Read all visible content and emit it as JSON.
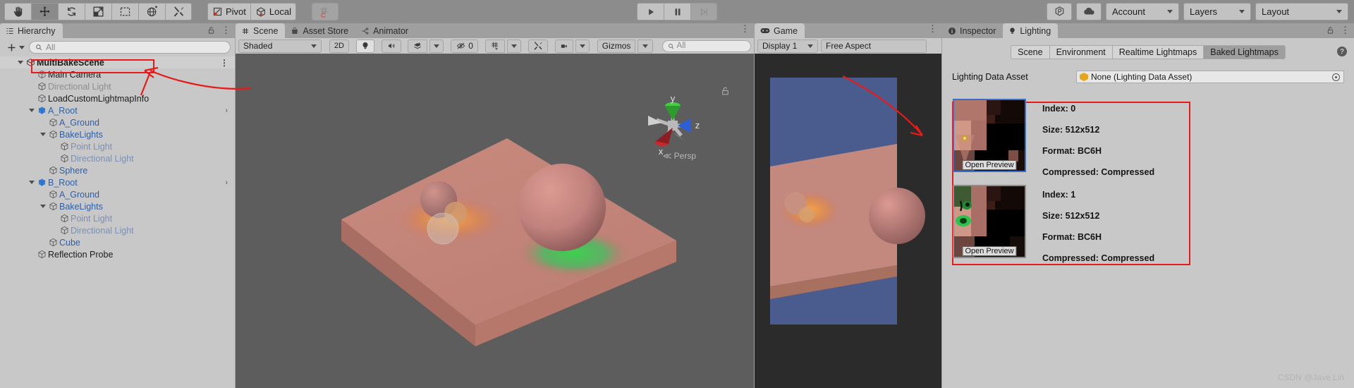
{
  "toolbar": {
    "tools": [
      {
        "name": "hand-tool",
        "icon": "hand",
        "active": false
      },
      {
        "name": "move-tool",
        "icon": "move",
        "active": true
      },
      {
        "name": "rotate-tool",
        "icon": "rotate",
        "active": false
      },
      {
        "name": "scale-tool",
        "icon": "scale",
        "active": false
      },
      {
        "name": "rect-tool",
        "icon": "rect",
        "active": false
      },
      {
        "name": "transform-tool",
        "icon": "transform",
        "active": false
      },
      {
        "name": "custom-tool",
        "icon": "wrench",
        "active": false
      }
    ],
    "pivot_label": "Pivot",
    "local_label": "Local",
    "snap_label": "",
    "play_label": "play",
    "pause_label": "pause",
    "step_label": "step",
    "collab_label": "collab",
    "cloud_label": "cloud",
    "account_label": "Account",
    "layers_label": "Layers",
    "layout_label": "Layout"
  },
  "hierarchy": {
    "tab": "Hierarchy",
    "search_placeholder": "All",
    "create_label": "+",
    "items": [
      {
        "label": "MultiBakeScene",
        "depth": 0,
        "style": "scene",
        "twisty": "open",
        "icon": "scene-icon",
        "kebab": true
      },
      {
        "label": "Main Camera",
        "depth": 1,
        "style": "normal",
        "twisty": "none",
        "icon": "gameobject-icon"
      },
      {
        "label": "Directional Light",
        "depth": 1,
        "style": "dimmed",
        "twisty": "none",
        "icon": "gameobject-icon"
      },
      {
        "label": "LoadCustomLightmapInfo",
        "depth": 1,
        "style": "normal",
        "twisty": "none",
        "icon": "gameobject-icon"
      },
      {
        "label": "A_Root",
        "depth": 1,
        "style": "blue",
        "twisty": "open",
        "icon": "prefab-icon",
        "chevron": true
      },
      {
        "label": "A_Ground",
        "depth": 2,
        "style": "blue",
        "twisty": "none",
        "icon": "gameobject-icon"
      },
      {
        "label": "BakeLights",
        "depth": 2,
        "style": "blue",
        "twisty": "open",
        "icon": "gameobject-icon"
      },
      {
        "label": "Point Light",
        "depth": 3,
        "style": "bluedim",
        "twisty": "none",
        "icon": "gameobject-icon"
      },
      {
        "label": "Directional Light",
        "depth": 3,
        "style": "bluedim",
        "twisty": "none",
        "icon": "gameobject-icon"
      },
      {
        "label": "Sphere",
        "depth": 2,
        "style": "blue",
        "twisty": "none",
        "icon": "gameobject-icon"
      },
      {
        "label": "B_Root",
        "depth": 1,
        "style": "blue",
        "twisty": "open",
        "icon": "prefab-icon",
        "chevron": true
      },
      {
        "label": "A_Ground",
        "depth": 2,
        "style": "blue",
        "twisty": "none",
        "icon": "gameobject-icon"
      },
      {
        "label": "BakeLights",
        "depth": 2,
        "style": "blue",
        "twisty": "open",
        "icon": "gameobject-icon"
      },
      {
        "label": "Point Light",
        "depth": 3,
        "style": "bluedim",
        "twisty": "none",
        "icon": "gameobject-icon"
      },
      {
        "label": "Directional Light",
        "depth": 3,
        "style": "bluedim",
        "twisty": "none",
        "icon": "gameobject-icon"
      },
      {
        "label": "Cube",
        "depth": 2,
        "style": "blue",
        "twisty": "none",
        "icon": "gameobject-icon"
      },
      {
        "label": "Reflection Probe",
        "depth": 1,
        "style": "normal",
        "twisty": "none",
        "icon": "gameobject-icon"
      }
    ]
  },
  "scene": {
    "tabs": [
      {
        "label": "Scene",
        "icon": "scene-grid-icon",
        "active": true
      },
      {
        "label": "Asset Store",
        "icon": "store-bag-icon",
        "active": false
      },
      {
        "label": "Animator",
        "icon": "animator-icon",
        "active": false
      }
    ],
    "draw_mode": "Shaded",
    "two_d_label": "2D",
    "light_toggle": "light-bulb-icon",
    "audio_toggle": "audio-icon",
    "fx_label": "fx-layers-icon",
    "hidden_count": "0",
    "grid_label": "grid-icon",
    "camera_label": "camera-icon",
    "gizmos_label": "Gizmos",
    "search_placeholder": "All",
    "axis": {
      "x": "x",
      "y": "y",
      "z": "z",
      "mode": "Persp"
    }
  },
  "game": {
    "tab": "Game",
    "display": "Display 1",
    "aspect": "Free Aspect"
  },
  "lighting": {
    "tabs": [
      {
        "label": "Inspector",
        "icon": "info-icon",
        "active": false
      },
      {
        "label": "Lighting",
        "icon": "bulb-icon",
        "active": true
      }
    ],
    "subtabs": [
      {
        "label": "Scene",
        "active": false
      },
      {
        "label": "Environment",
        "active": false
      },
      {
        "label": "Realtime Lightmaps",
        "active": false
      },
      {
        "label": "Baked Lightmaps",
        "active": true
      }
    ],
    "data_asset_label": "Lighting Data Asset",
    "data_asset_value": "None (Lighting Data Asset)",
    "lightmaps": [
      {
        "index_label": "Index: 0",
        "size_label": "Size: 512x512",
        "format_label": "Format: BC6H",
        "compressed_label": "Compressed: Compressed",
        "preview_button": "Open Preview",
        "selected": true
      },
      {
        "index_label": "Index: 1",
        "size_label": "Size: 512x512",
        "format_label": "Format: BC6H",
        "compressed_label": "Compressed: Compressed",
        "preview_button": "Open Preview",
        "selected": false
      }
    ]
  },
  "watermark": "CSDN @Jave.Lin",
  "colors": {
    "accent_red": "#e81b1b",
    "selection_blue": "#3b6ec4",
    "hierarchy_blue": "#2f5fa8",
    "toolbar_bg": "#8c8c8c",
    "panel_bg": "#c8c8c8"
  }
}
